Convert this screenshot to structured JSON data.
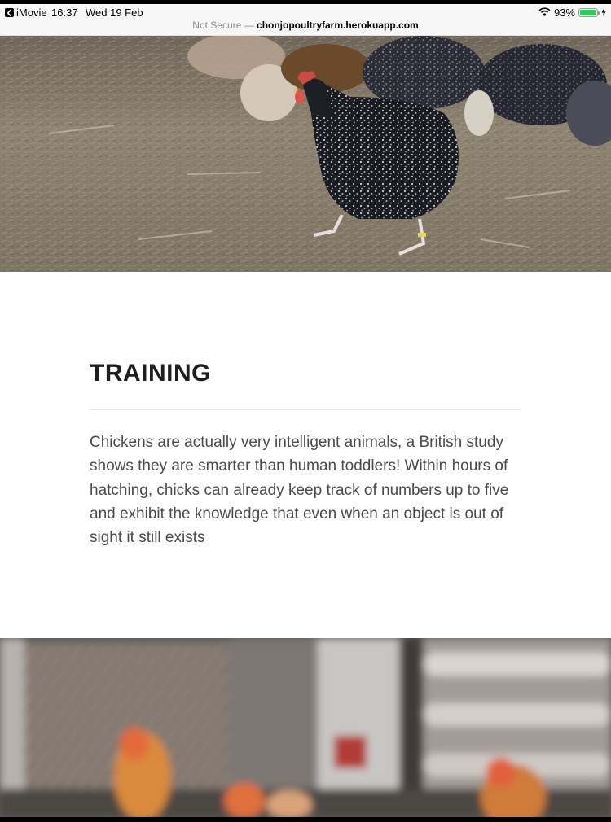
{
  "status_bar": {
    "back_app": "iMovie",
    "time": "16:37",
    "date": "Wed 19 Feb",
    "battery_percent": "93%",
    "battery_level": 0.93,
    "icons": [
      "chevron-left-icon",
      "wifi-icon",
      "battery-icon",
      "charging-bolt-icon"
    ]
  },
  "url_bar": {
    "security": "Not Secure —",
    "domain": "chonjopoultryfarm.herokuapp.com"
  },
  "section": {
    "title": "TRAINING",
    "body": "Chickens are actually very intelligent animals, a British study shows they are smarter than human toddlers! Within hours of hatching, chicks can already keep track of numbers up to five and exhibit the knowledge that even when an object is out of sight it still exists"
  },
  "colors": {
    "battery_green": "#34c759",
    "heading": "#1e1e1e",
    "body_text": "#4a4a4a"
  }
}
